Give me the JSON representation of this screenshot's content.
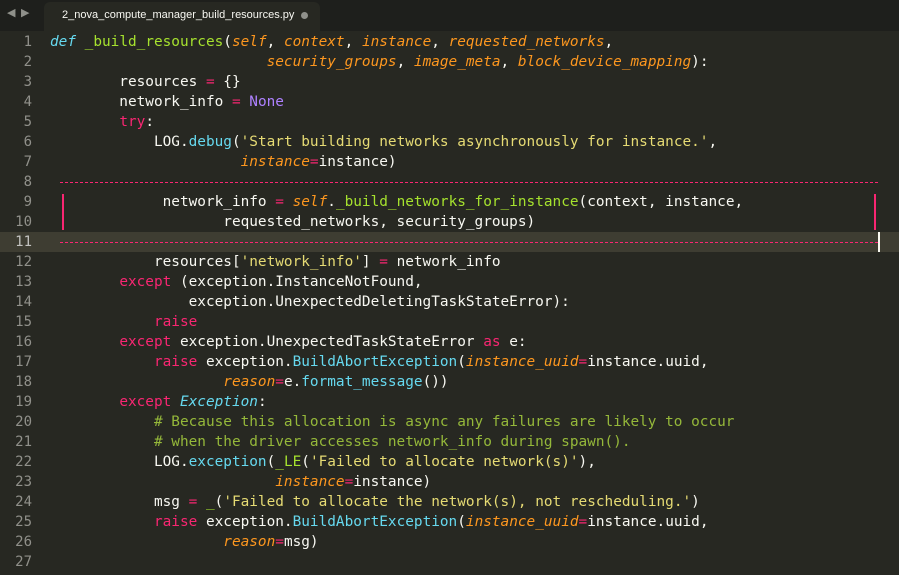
{
  "window": {
    "tab_title": "2_nova_compute_manager_build_resources.py",
    "nav_arrows": "◀ ▶"
  },
  "theme": {
    "background": "#272822",
    "keyword": "#f92672",
    "function": "#a6e22e",
    "parameter": "#fd971f",
    "string": "#e6db74",
    "builtin": "#66d9ef",
    "constant": "#ae81ff",
    "comment": "#75715e",
    "highlight_comment": "#95b83a",
    "text": "#f8f8f2"
  },
  "editor": {
    "current_line": 11,
    "lines": [
      {
        "n": "1",
        "segs": [
          [
            "def",
            "sdef"
          ],
          [
            " ",
            "t"
          ],
          [
            "_build_resources",
            "fn"
          ],
          [
            "(",
            "t"
          ],
          [
            "self",
            "par"
          ],
          [
            ", ",
            "t"
          ],
          [
            "context",
            "par"
          ],
          [
            ", ",
            "t"
          ],
          [
            "instance",
            "par"
          ],
          [
            ", ",
            "t"
          ],
          [
            "requested_networks",
            "par"
          ],
          [
            ",",
            "t"
          ]
        ]
      },
      {
        "n": "2",
        "segs": [
          [
            "                         ",
            "t"
          ],
          [
            "security_groups",
            "par"
          ],
          [
            ", ",
            "t"
          ],
          [
            "image_meta",
            "par"
          ],
          [
            ", ",
            "t"
          ],
          [
            "block_device_mapping",
            "par"
          ],
          [
            "):",
            "t"
          ]
        ]
      },
      {
        "n": "3",
        "segs": [
          [
            "        resources ",
            "t"
          ],
          [
            "=",
            "kw"
          ],
          [
            " {}",
            "t"
          ]
        ]
      },
      {
        "n": "4",
        "segs": [
          [
            "        network_info ",
            "t"
          ],
          [
            "=",
            "kw"
          ],
          [
            " ",
            "t"
          ],
          [
            "None",
            "const"
          ]
        ]
      },
      {
        "n": "5",
        "segs": [
          [
            "        ",
            "t"
          ],
          [
            "try",
            "kw"
          ],
          [
            ":",
            "t"
          ]
        ]
      },
      {
        "n": "6",
        "segs": [
          [
            "            LOG.",
            "t"
          ],
          [
            "debug",
            "bi"
          ],
          [
            "(",
            "t"
          ],
          [
            "'Start building networks asynchronously for instance.'",
            "str"
          ],
          [
            ",",
            "t"
          ]
        ]
      },
      {
        "n": "7",
        "segs": [
          [
            "                      ",
            "t"
          ],
          [
            "instance",
            "ipar"
          ],
          [
            "=",
            "kw"
          ],
          [
            "instance)",
            "t"
          ]
        ]
      },
      {
        "n": "8",
        "segs": []
      },
      {
        "n": "9",
        "segs": [
          [
            "             network_info ",
            "t"
          ],
          [
            "=",
            "kw"
          ],
          [
            " ",
            "t"
          ],
          [
            "self",
            "ipar"
          ],
          [
            ".",
            "t"
          ],
          [
            "_build_networks_for_instance",
            "fn"
          ],
          [
            "(context, instance,",
            "t"
          ]
        ]
      },
      {
        "n": "10",
        "segs": [
          [
            "                    requested_networks, security_groups)",
            "t"
          ]
        ]
      },
      {
        "n": "11",
        "segs": []
      },
      {
        "n": "12",
        "segs": [
          [
            "            resources[",
            "t"
          ],
          [
            "'network_info'",
            "str"
          ],
          [
            "] ",
            "t"
          ],
          [
            "=",
            "kw"
          ],
          [
            " network_info",
            "t"
          ]
        ]
      },
      {
        "n": "13",
        "segs": [
          [
            "        ",
            "t"
          ],
          [
            "except",
            "kw"
          ],
          [
            " (exception.InstanceNotFound,",
            "t"
          ]
        ]
      },
      {
        "n": "14",
        "segs": [
          [
            "                exception.UnexpectedDeletingTaskStateError):",
            "t"
          ]
        ]
      },
      {
        "n": "15",
        "segs": [
          [
            "            ",
            "t"
          ],
          [
            "raise",
            "kw"
          ]
        ]
      },
      {
        "n": "16",
        "segs": [
          [
            "        ",
            "t"
          ],
          [
            "except",
            "kw"
          ],
          [
            " exception.UnexpectedTaskStateError ",
            "t"
          ],
          [
            "as",
            "kw"
          ],
          [
            " e:",
            "t"
          ]
        ]
      },
      {
        "n": "17",
        "segs": [
          [
            "            ",
            "t"
          ],
          [
            "raise",
            "kw"
          ],
          [
            " exception.",
            "t"
          ],
          [
            "BuildAbortException",
            "bi"
          ],
          [
            "(",
            "t"
          ],
          [
            "instance_uuid",
            "ipar"
          ],
          [
            "=",
            "kw"
          ],
          [
            "instance.uuid,",
            "t"
          ]
        ]
      },
      {
        "n": "18",
        "segs": [
          [
            "                    ",
            "t"
          ],
          [
            "reason",
            "ipar"
          ],
          [
            "=",
            "kw"
          ],
          [
            "e.",
            "t"
          ],
          [
            "format_message",
            "bi"
          ],
          [
            "())",
            "t"
          ]
        ]
      },
      {
        "n": "19",
        "segs": [
          [
            "        ",
            "t"
          ],
          [
            "except",
            "kw"
          ],
          [
            " ",
            "t"
          ],
          [
            "Exception",
            "ibi"
          ],
          [
            ":",
            "t"
          ]
        ]
      },
      {
        "n": "20",
        "segs": [
          [
            "            ",
            "t"
          ],
          [
            "# Because this allocation is async any failures are likely to occur",
            "cmt"
          ]
        ]
      },
      {
        "n": "21",
        "segs": [
          [
            "            ",
            "t"
          ],
          [
            "# when the driver accesses network_info during spawn().",
            "cmt"
          ]
        ]
      },
      {
        "n": "22",
        "segs": [
          [
            "            LOG.",
            "t"
          ],
          [
            "exception",
            "bi"
          ],
          [
            "(",
            "t"
          ],
          [
            "_LE",
            "fn"
          ],
          [
            "(",
            "t"
          ],
          [
            "'Failed to allocate network(s)'",
            "str"
          ],
          [
            "),",
            "t"
          ]
        ]
      },
      {
        "n": "23",
        "segs": [
          [
            "                          ",
            "t"
          ],
          [
            "instance",
            "ipar"
          ],
          [
            "=",
            "kw"
          ],
          [
            "instance)",
            "t"
          ]
        ]
      },
      {
        "n": "24",
        "segs": [
          [
            "            msg ",
            "t"
          ],
          [
            "=",
            "kw"
          ],
          [
            " ",
            "t"
          ],
          [
            "_",
            "fn"
          ],
          [
            "(",
            "t"
          ],
          [
            "'Failed to allocate the network(s), not rescheduling.'",
            "str"
          ],
          [
            ")",
            "t"
          ]
        ]
      },
      {
        "n": "25",
        "segs": [
          [
            "            ",
            "t"
          ],
          [
            "raise",
            "kw"
          ],
          [
            " exception.",
            "t"
          ],
          [
            "BuildAbortException",
            "bi"
          ],
          [
            "(",
            "t"
          ],
          [
            "instance_uuid",
            "ipar"
          ],
          [
            "=",
            "kw"
          ],
          [
            "instance.uuid,",
            "t"
          ]
        ]
      },
      {
        "n": "26",
        "segs": [
          [
            "                    ",
            "t"
          ],
          [
            "reason",
            "ipar"
          ],
          [
            "=",
            "kw"
          ],
          [
            "msg)",
            "t"
          ]
        ]
      },
      {
        "n": "27",
        "segs": []
      }
    ]
  }
}
